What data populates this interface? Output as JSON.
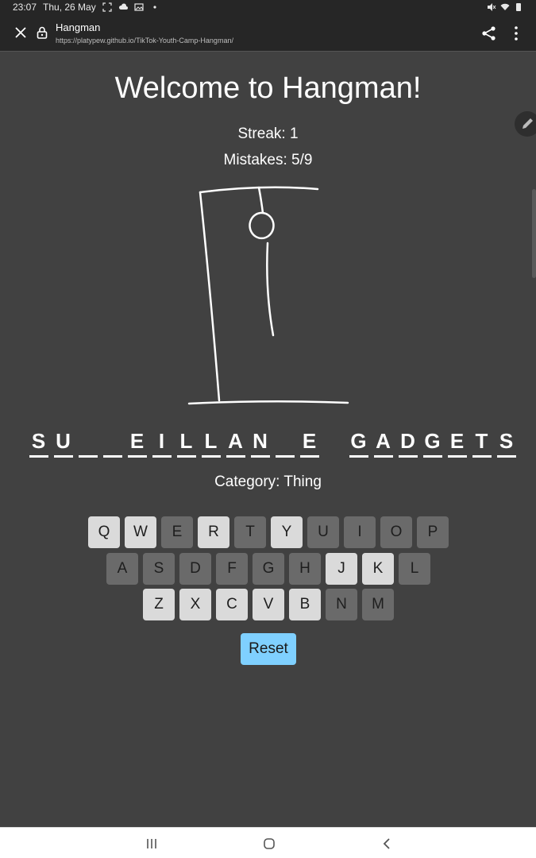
{
  "status_bar": {
    "time": "23:07",
    "date": "Thu, 26 May",
    "icons_left": [
      "screenshot-icon",
      "cloud-icon",
      "gallery-icon",
      "dot-icon"
    ],
    "icons_right": [
      "mute-icon",
      "wifi-icon",
      "battery-icon"
    ]
  },
  "browser": {
    "page_title": "Hangman",
    "url": "https://platypew.github.io/TikTok-Youth-Camp-Hangman/"
  },
  "game": {
    "heading": "Welcome to Hangman!",
    "streak": "Streak: 1",
    "mistakes": "Mistakes: 5/9",
    "word_slots": [
      "S",
      "U",
      "",
      "",
      "E",
      "I",
      "L",
      "L",
      "A",
      "N",
      "",
      "E",
      " ",
      "G",
      "A",
      "D",
      "G",
      "E",
      "T",
      "S"
    ],
    "category": "Category: Thing",
    "keyboard": [
      [
        {
          "k": "Q",
          "used": false
        },
        {
          "k": "W",
          "used": false
        },
        {
          "k": "E",
          "used": true
        },
        {
          "k": "R",
          "used": false
        },
        {
          "k": "T",
          "used": true
        },
        {
          "k": "Y",
          "used": false
        },
        {
          "k": "U",
          "used": true
        },
        {
          "k": "I",
          "used": true
        },
        {
          "k": "O",
          "used": true
        },
        {
          "k": "P",
          "used": true
        }
      ],
      [
        {
          "k": "A",
          "used": true
        },
        {
          "k": "S",
          "used": true
        },
        {
          "k": "D",
          "used": true
        },
        {
          "k": "F",
          "used": true
        },
        {
          "k": "G",
          "used": true
        },
        {
          "k": "H",
          "used": true
        },
        {
          "k": "J",
          "used": false
        },
        {
          "k": "K",
          "used": false
        },
        {
          "k": "L",
          "used": true
        }
      ],
      [
        {
          "k": "Z",
          "used": false
        },
        {
          "k": "X",
          "used": false
        },
        {
          "k": "C",
          "used": false
        },
        {
          "k": "V",
          "used": false
        },
        {
          "k": "B",
          "used": false
        },
        {
          "k": "N",
          "used": true
        },
        {
          "k": "M",
          "used": true
        }
      ]
    ],
    "reset_label": "Reset"
  },
  "colors": {
    "page_bg": "#414141",
    "reset_bg": "#7fd0ff",
    "key_used": "#6a6a6a",
    "key_available": "#dadada"
  }
}
